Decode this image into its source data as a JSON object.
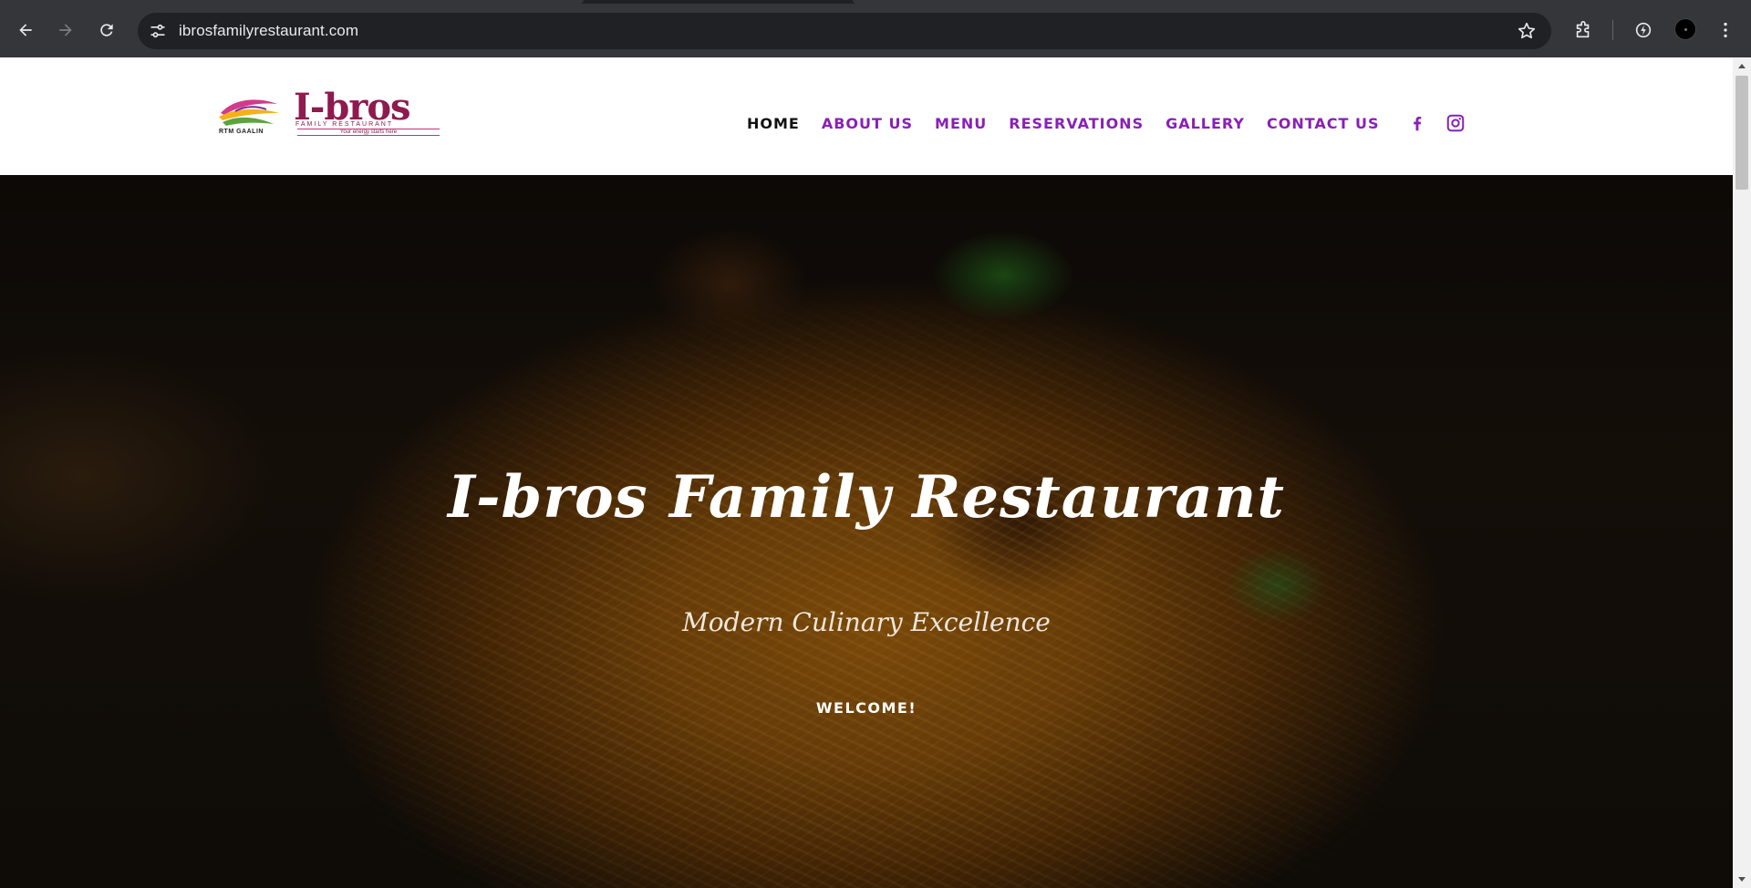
{
  "browser": {
    "url": "ibrosfamilyrestaurant.com",
    "icons": {
      "back": "back-arrow-icon",
      "forward": "forward-arrow-icon",
      "reload": "reload-icon",
      "site_info": "tune-icon",
      "bookmark": "star-icon",
      "extensions": "puzzle-icon",
      "performance": "speed-icon",
      "menu": "kebab-menu-icon"
    }
  },
  "header": {
    "logo": {
      "name": "I-bros",
      "subtitle": "FAMILY RESTAURANT",
      "tagline": "Your energy starts here",
      "brand_mark": "RTM GAALIN"
    },
    "nav": [
      {
        "label": "HOME",
        "active": true
      },
      {
        "label": "ABOUT US",
        "active": false
      },
      {
        "label": "MENU",
        "active": false
      },
      {
        "label": "RESERVATIONS",
        "active": false
      },
      {
        "label": "GALLERY",
        "active": false
      },
      {
        "label": "CONTACT US",
        "active": false
      }
    ],
    "social": [
      "facebook-icon",
      "instagram-icon"
    ],
    "colors": {
      "accent": "#8a1fb8",
      "active": "#111111",
      "logo": "#8e1a4e"
    }
  },
  "hero": {
    "title": "I-bros Family Restaurant",
    "subtitle": "Modern Culinary Excellence",
    "cta": "WELCOME!"
  }
}
